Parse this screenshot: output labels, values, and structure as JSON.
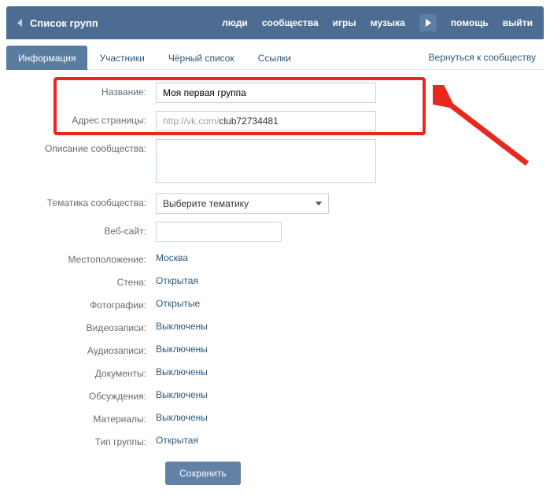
{
  "topbar": {
    "breadcrumb": "Список групп",
    "nav": {
      "people": "люди",
      "communities": "сообщества",
      "games": "игры",
      "music": "музыка",
      "help": "помощь",
      "logout": "выйти"
    }
  },
  "tabs": {
    "info": "Информация",
    "members": "Участники",
    "blacklist": "Чёрный список",
    "links": "Ссылки",
    "back_to_community": "Вернуться к сообществу"
  },
  "form": {
    "name_label": "Название:",
    "name_value": "Моя первая группа",
    "address_label": "Адрес страницы:",
    "address_prefix": "http://vk.com/",
    "address_suffix": "club72734481",
    "description_label": "Описание сообщества:",
    "description_value": "",
    "topic_label": "Тематика сообщества:",
    "topic_value": "Выберите тематику",
    "website_label": "Веб-сайт:",
    "website_value": "",
    "location_label": "Местоположение:",
    "location_value": "Москва",
    "wall_label": "Стена:",
    "wall_value": "Открытая",
    "photos_label": "Фотографии:",
    "photos_value": "Открытые",
    "videos_label": "Видеозаписи:",
    "videos_value": "Выключены",
    "audios_label": "Аудиозаписи:",
    "audios_value": "Выключены",
    "docs_label": "Документы:",
    "docs_value": "Выключены",
    "discussions_label": "Обсуждения:",
    "discussions_value": "Выключены",
    "materials_label": "Материалы:",
    "materials_value": "Выключены",
    "group_type_label": "Тип группы:",
    "group_type_value": "Открытая",
    "save_button": "Сохранить"
  }
}
